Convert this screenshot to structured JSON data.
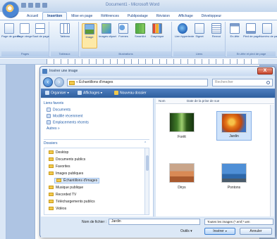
{
  "window": {
    "title": "Document1 - Microsoft Word"
  },
  "ribbon": {
    "tabs": [
      "Accueil",
      "Insertion",
      "Mise en page",
      "Références",
      "Publipostage",
      "Révision",
      "Affichage",
      "Développeur"
    ],
    "active_tab": "Insertion",
    "buttons": [
      {
        "label": "Page de garde"
      },
      {
        "label": "Page vierge"
      },
      {
        "label": "Saut de page"
      },
      {
        "label": "Tableau"
      },
      {
        "label": "Image"
      },
      {
        "label": "Images clipart"
      },
      {
        "label": "Formes"
      },
      {
        "label": "SmartArt"
      },
      {
        "label": "Graphique"
      },
      {
        "label": "Lien hypertexte"
      },
      {
        "label": "Signet"
      },
      {
        "label": "Renvoi"
      },
      {
        "label": "En-tête"
      },
      {
        "label": "Pied de page"
      },
      {
        "label": "Numéro de page"
      }
    ],
    "groups": [
      "Pages",
      "Tableaux",
      "Illustrations",
      "Liens",
      "En-tête et pied de page"
    ]
  },
  "dialog": {
    "title": "Insérer une image",
    "close_label": "X",
    "address": "« Échantillons d'images",
    "search_placeholder": "Rechercher",
    "toolbar": [
      "Organiser",
      "Affichages",
      "Nouveau dossier"
    ],
    "nav": {
      "favorites_header": "Liens favoris",
      "favorites": [
        "Documents",
        "Modifié récemment",
        "Emplacements récents"
      ],
      "more": "Autres »",
      "folders_header": "Dossiers",
      "tree": [
        "Desktop",
        "Documents publics",
        "Favorites",
        "Images publiques",
        "Échantillons d'images",
        "Musique publique",
        "Recorded TV",
        "Téléchargements publics",
        "Vidéos"
      ]
    },
    "columns": [
      "Nom",
      "Date de la prise de vue"
    ],
    "files": [
      {
        "name": "Forêt"
      },
      {
        "name": "Jardin"
      },
      {
        "name": "Dirys"
      },
      {
        "name": "Pontons"
      }
    ],
    "filename_label": "Nom de fichier :",
    "filename_value": "Jardin",
    "file_type": "Toutes les images (*.emf;*.wm",
    "tools_label": "Outils",
    "insert_label": "Insérer",
    "cancel_label": "Annuler"
  }
}
